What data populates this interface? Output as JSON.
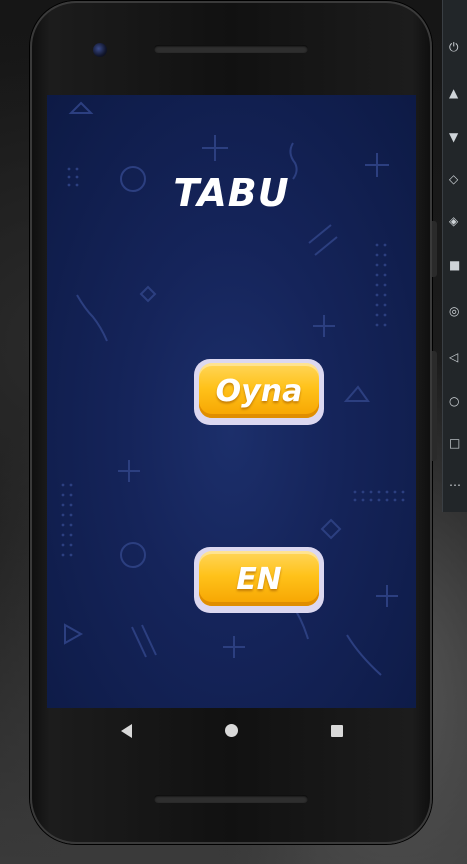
{
  "app": {
    "title": "TABU",
    "buttons": {
      "play_label": "Oyna",
      "language_label": "EN"
    }
  },
  "colors": {
    "screen_background": "#15245a",
    "button_gold": "#ffc21a",
    "button_border": "#dcd8f0",
    "title_text": "#ffffff"
  },
  "system_nav": {
    "back_icon": "back-triangle-icon",
    "home_icon": "home-circle-icon",
    "recents_icon": "recents-square-icon"
  }
}
